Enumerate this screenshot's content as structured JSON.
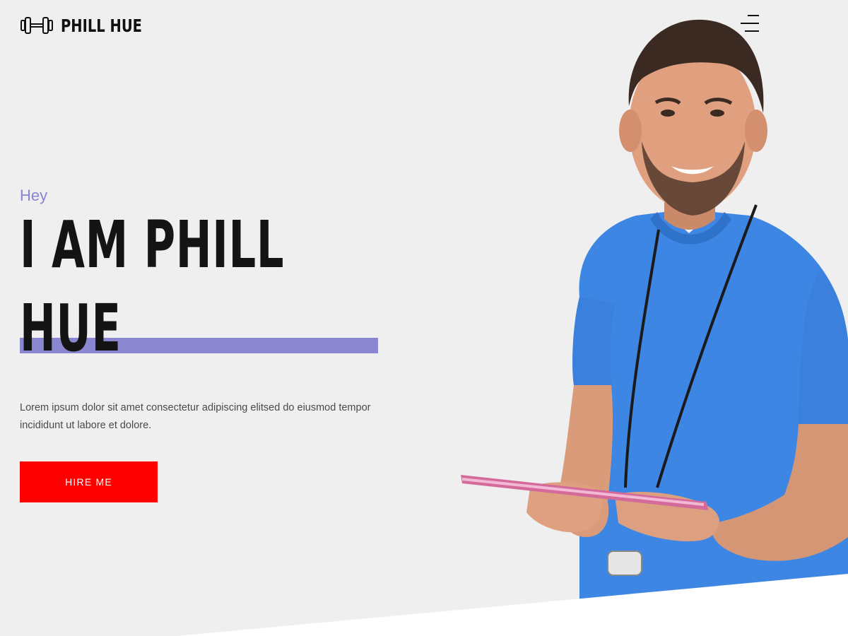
{
  "header": {
    "brand_name": "PHILL HUE",
    "logo_icon": "dumbbell-icon",
    "menu_icon": "hamburger-menu-icon"
  },
  "hero": {
    "greeting": "Hey",
    "title": "I AM PHILL HUE",
    "description": "Lorem ipsum dolor sit amet consectetur adipiscing elitsed do eiusmod tempor incididunt ut labore et dolore.",
    "cta_label": "HIRE ME"
  },
  "colors": {
    "accent_purple": "#8b86d0",
    "greeting_purple": "#8a84d3",
    "cta_red": "#ff0000",
    "background": "#efefef",
    "shirt_blue": "#3d86e4"
  }
}
